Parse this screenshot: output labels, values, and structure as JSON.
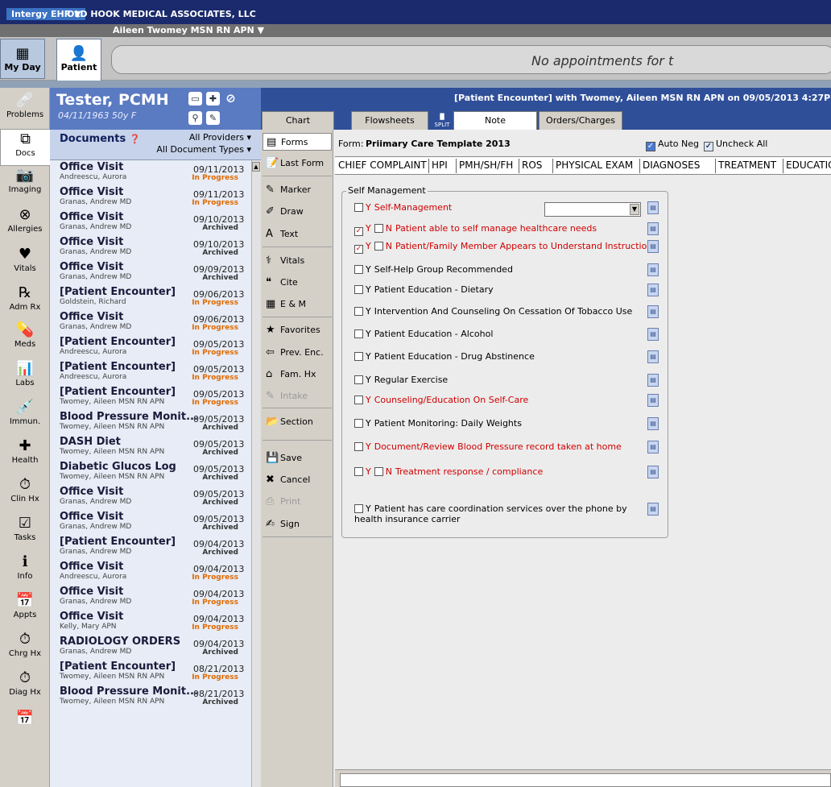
{
  "titlebar": {
    "app_menu": "Intergy EHR ▼",
    "practice": "OLD HOOK MEDICAL ASSOCIATES, LLC"
  },
  "userbar": {
    "user": "Aileen Twomey MSN RN APN ▼"
  },
  "toolbar": {
    "myday": "My Day",
    "patient": "Patient",
    "appointments": "No appointments for t"
  },
  "nav": [
    {
      "label": "Problems",
      "icon": "bandage-icon",
      "glyph": "🩹"
    },
    {
      "label": "Docs",
      "icon": "documents-icon",
      "glyph": "⧉"
    },
    {
      "label": "Imaging",
      "icon": "camera-icon",
      "glyph": "📷"
    },
    {
      "label": "Allergies",
      "icon": "allergies-icon",
      "glyph": "⊗"
    },
    {
      "label": "Vitals",
      "icon": "vitals-icon",
      "glyph": "♥"
    },
    {
      "label": "Adm Rx",
      "icon": "rx-icon",
      "glyph": "℞"
    },
    {
      "label": "Meds",
      "icon": "pill-icon",
      "glyph": "💊"
    },
    {
      "label": "Labs",
      "icon": "labs-icon",
      "glyph": "📊"
    },
    {
      "label": "Immun.",
      "icon": "syringe-icon",
      "glyph": "💉"
    },
    {
      "label": "Health",
      "icon": "health-icon",
      "glyph": "✚"
    },
    {
      "label": "Clin Hx",
      "icon": "clock-icon",
      "glyph": "⏱"
    },
    {
      "label": "Tasks",
      "icon": "checkmark-icon",
      "glyph": "☑"
    },
    {
      "label": "Info",
      "icon": "info-icon",
      "glyph": "ℹ"
    },
    {
      "label": "Appts",
      "icon": "calendar-icon",
      "glyph": "📅"
    },
    {
      "label": "Chrg Hx",
      "icon": "charge-history-icon",
      "glyph": "⏱"
    },
    {
      "label": "Diag Hx",
      "icon": "diagnosis-history-icon",
      "glyph": "⏱"
    },
    {
      "label": "",
      "icon": "more-icon",
      "glyph": "📅"
    }
  ],
  "patient": {
    "name": "Tester, PCMH",
    "dob": "04/11/1963  50y F"
  },
  "encounter": {
    "title": "[Patient Encounter]  with Twomey, Aileen MSN RN APN  on 09/05/2013 4:27P"
  },
  "tabs": {
    "chart": "Chart",
    "flowsheets": "Flowsheets",
    "split": "SPLIT",
    "note": "Note",
    "orders": "Orders/Charges"
  },
  "documents": {
    "title": "Documents",
    "providers": "All Providers ▾",
    "types": "All Document Types ▾",
    "items": [
      {
        "title": "Office Visit",
        "author": "Andreescu, Aurora",
        "date": "09/11/2013",
        "status": "In Progress"
      },
      {
        "title": "Office Visit",
        "author": "Granas, Andrew MD",
        "date": "09/11/2013",
        "status": "In Progress"
      },
      {
        "title": "Office Visit",
        "author": "Granas, Andrew MD",
        "date": "09/10/2013",
        "status": "Archived"
      },
      {
        "title": "Office Visit",
        "author": "Granas, Andrew MD",
        "date": "09/10/2013",
        "status": "Archived"
      },
      {
        "title": "Office Visit",
        "author": "Granas, Andrew MD",
        "date": "09/09/2013",
        "status": "Archived"
      },
      {
        "title": "[Patient Encounter]",
        "author": "Goldstein, Richard",
        "date": "09/06/2013",
        "status": "In Progress"
      },
      {
        "title": "Office Visit",
        "author": "Granas, Andrew MD",
        "date": "09/06/2013",
        "status": "In Progress"
      },
      {
        "title": "[Patient Encounter]",
        "author": "Andreescu, Aurora",
        "date": "09/05/2013",
        "status": "In Progress"
      },
      {
        "title": "[Patient Encounter]",
        "author": "Andreescu, Aurora",
        "date": "09/05/2013",
        "status": "In Progress"
      },
      {
        "title": "[Patient Encounter]",
        "author": "Twomey, Aileen MSN RN APN",
        "date": "09/05/2013",
        "status": "In Progress"
      },
      {
        "title": "Blood Pressure Monit...",
        "author": "Twomey, Aileen MSN RN APN",
        "date": "09/05/2013",
        "status": "Archived"
      },
      {
        "title": "DASH Diet",
        "author": "Twomey, Aileen MSN RN APN",
        "date": "09/05/2013",
        "status": "Archived"
      },
      {
        "title": "Diabetic Glucos Log",
        "author": "Twomey, Aileen MSN RN APN",
        "date": "09/05/2013",
        "status": "Archived"
      },
      {
        "title": "Office Visit",
        "author": "Granas, Andrew MD",
        "date": "09/05/2013",
        "status": "Archived"
      },
      {
        "title": "Office Visit",
        "author": "Granas, Andrew MD",
        "date": "09/05/2013",
        "status": "Archived"
      },
      {
        "title": "[Patient Encounter]",
        "author": "Granas, Andrew MD",
        "date": "09/04/2013",
        "status": "Archived"
      },
      {
        "title": "Office Visit",
        "author": "Andreescu, Aurora",
        "date": "09/04/2013",
        "status": "In Progress"
      },
      {
        "title": "Office Visit",
        "author": "Granas, Andrew MD",
        "date": "09/04/2013",
        "status": "In Progress"
      },
      {
        "title": "Office Visit",
        "author": "Kelly, Mary APN",
        "date": "09/04/2013",
        "status": "In Progress"
      },
      {
        "title": "RADIOLOGY ORDERS",
        "author": "Granas, Andrew MD",
        "date": "09/04/2013",
        "status": "Archived"
      },
      {
        "title": "[Patient Encounter]",
        "author": "Twomey, Aileen MSN RN APN",
        "date": "08/21/2013",
        "status": "In Progress"
      },
      {
        "title": "Blood Pressure Monit...",
        "author": "Twomey, Aileen MSN RN APN",
        "date": "08/21/2013",
        "status": "Archived"
      }
    ]
  },
  "commands": [
    {
      "label": "Forms",
      "icon": "forms-icon",
      "glyph": "▤"
    },
    {
      "label": "Last Form",
      "icon": "last-form-icon",
      "glyph": "📝"
    },
    {
      "label": "Marker",
      "icon": "marker-icon",
      "glyph": "✎"
    },
    {
      "label": "Draw",
      "icon": "draw-icon",
      "glyph": "✐"
    },
    {
      "label": "Text",
      "icon": "text-icon",
      "glyph": "A"
    },
    {
      "label": "Vitals",
      "icon": "vitals-cmd-icon",
      "glyph": "⚕"
    },
    {
      "label": "Cite",
      "icon": "cite-icon",
      "glyph": "❝"
    },
    {
      "label": "E & M",
      "icon": "em-icon",
      "glyph": "▦"
    },
    {
      "label": "Favorites",
      "icon": "favorites-icon",
      "glyph": "★"
    },
    {
      "label": "Prev. Enc.",
      "icon": "previous-encounter-icon",
      "glyph": "⇦"
    },
    {
      "label": "Fam. Hx",
      "icon": "family-history-icon",
      "glyph": "⌂"
    },
    {
      "label": "Intake",
      "icon": "intake-icon",
      "glyph": "✎"
    },
    {
      "label": "Section",
      "icon": "section-icon",
      "glyph": "📂"
    },
    {
      "label": "Save",
      "icon": "save-icon",
      "glyph": "💾"
    },
    {
      "label": "Cancel",
      "icon": "cancel-icon",
      "glyph": "✖"
    },
    {
      "label": "Print",
      "icon": "print-icon",
      "glyph": "⎙"
    },
    {
      "label": "Sign",
      "icon": "sign-icon",
      "glyph": "✍"
    }
  ],
  "form": {
    "label": "Form:",
    "name": "Priimary Care Template 2013",
    "auto_neg": "Auto Neg",
    "uncheck_all": "Uncheck All",
    "sections": [
      "CHIEF COMPLAINT",
      "HPI",
      "PMH/SH/FH",
      "ROS",
      "PHYSICAL EXAM",
      "DIAGNOSES",
      "TREATMENT",
      "EDUCATION"
    ],
    "group_title": "Self Management",
    "items": [
      {
        "text": "Self-Management",
        "yes": "Y",
        "no": "",
        "red": true,
        "checked_y": false,
        "has_n": false
      },
      {
        "text": "Patient able to self manage healthcare needs",
        "yes": "Y",
        "no": "N",
        "red": true,
        "checked_y": true,
        "has_n": true
      },
      {
        "text": "Patient/Family Member Appears to Understand Instructions",
        "yes": "Y",
        "no": "N",
        "red": true,
        "checked_y": true,
        "has_n": true
      },
      {
        "text": "Self-Help Group Recommended",
        "yes": "Y",
        "no": "",
        "red": false,
        "checked_y": false,
        "has_n": false
      },
      {
        "text": "Patient Education - Dietary",
        "yes": "Y",
        "no": "",
        "red": false,
        "checked_y": false,
        "has_n": false
      },
      {
        "text": "Intervention And Counseling On Cessation Of Tobacco Use",
        "yes": "Y",
        "no": "",
        "red": false,
        "checked_y": false,
        "has_n": false
      },
      {
        "text": "Patient Education - Alcohol",
        "yes": "Y",
        "no": "",
        "red": false,
        "checked_y": false,
        "has_n": false
      },
      {
        "text": "Patient Education - Drug Abstinence",
        "yes": "Y",
        "no": "",
        "red": false,
        "checked_y": false,
        "has_n": false
      },
      {
        "text": "Regular Exercise",
        "yes": "Y",
        "no": "",
        "red": false,
        "checked_y": false,
        "has_n": false
      },
      {
        "text": "Counseling/Education On Self-Care",
        "yes": "Y",
        "no": "",
        "red": true,
        "checked_y": false,
        "has_n": false
      },
      {
        "text": "Patient Monitoring: Daily Weights",
        "yes": "Y",
        "no": "",
        "red": false,
        "checked_y": false,
        "has_n": false
      },
      {
        "text": "Document/Review Blood Pressure record  taken at home",
        "yes": "Y",
        "no": "",
        "red": true,
        "checked_y": false,
        "has_n": false
      },
      {
        "text": "Treatment response / compliance",
        "yes": "Y",
        "no": "N",
        "red": true,
        "checked_y": false,
        "has_n": true
      },
      {
        "text": "Patient has care coordination services over the phone by  health insurance carrier",
        "yes": "Y",
        "no": "",
        "red": false,
        "checked_y": false,
        "has_n": false
      }
    ]
  },
  "colors": {
    "in_progress": "#e06a00",
    "archived": "#333333",
    "red_item": "#d00000"
  }
}
